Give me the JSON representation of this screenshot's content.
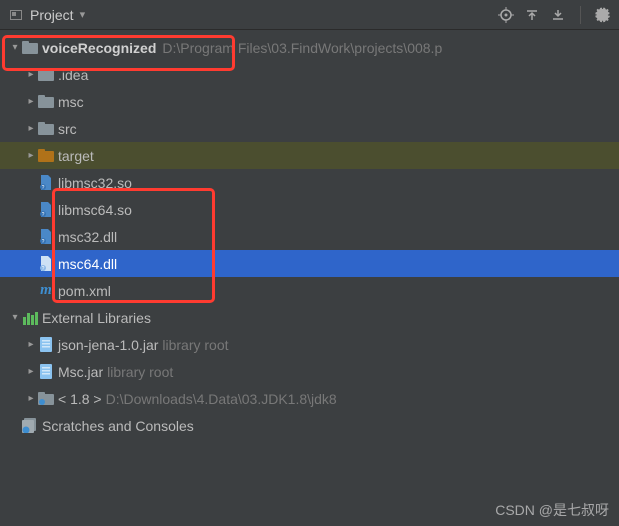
{
  "toolbar": {
    "title": "Project",
    "dropdown_icon": "▾"
  },
  "tree": {
    "root": {
      "name": "voiceRecognized",
      "path": "D:\\Program Files\\03.FindWork\\projects\\008.p"
    },
    "children": [
      {
        "name": ".idea",
        "type": "folder"
      },
      {
        "name": "msc",
        "type": "folder"
      },
      {
        "name": "src",
        "type": "folder"
      },
      {
        "name": "target",
        "type": "folder-orange"
      },
      {
        "name": "libmsc32.so",
        "type": "file"
      },
      {
        "name": "libmsc64.so",
        "type": "file"
      },
      {
        "name": "msc32.dll",
        "type": "file"
      },
      {
        "name": "msc64.dll",
        "type": "file",
        "selected": true
      },
      {
        "name": "pom.xml",
        "type": "maven"
      }
    ],
    "external": {
      "label": "External Libraries",
      "items": [
        {
          "name": "json-jena-1.0.jar",
          "suffix": "library root"
        },
        {
          "name": "Msc.jar",
          "suffix": "library root"
        },
        {
          "name": "< 1.8 >",
          "path": "D:\\Downloads\\4.Data\\03.JDK1.8\\jdk8"
        }
      ]
    },
    "scratches": "Scratches and Consoles"
  },
  "watermark": "CSDN @是七叔呀"
}
